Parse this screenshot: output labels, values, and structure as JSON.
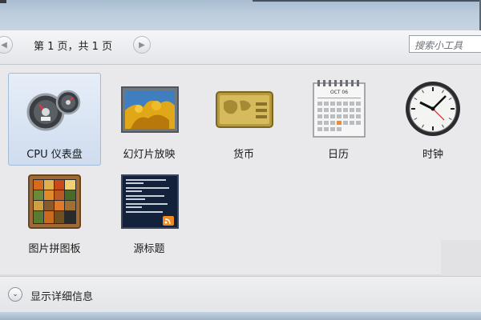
{
  "toolbar": {
    "page_info": "第 1 页，共 1 页",
    "prev_icon": "chevron-left-icon",
    "next_icon": "chevron-right-icon",
    "search_placeholder": "搜索小工具"
  },
  "gadgets": [
    {
      "label": "CPU 仪表盘",
      "icon": "cpu-meter-icon",
      "selected": true
    },
    {
      "label": "幻灯片放映",
      "icon": "slideshow-icon",
      "selected": false
    },
    {
      "label": "货币",
      "icon": "currency-icon",
      "selected": false
    },
    {
      "label": "日历",
      "icon": "calendar-icon",
      "selected": false
    },
    {
      "label": "时钟",
      "icon": "clock-icon",
      "selected": false
    },
    {
      "label": "图片拼图板",
      "icon": "picture-puzzle-icon",
      "selected": false
    },
    {
      "label": "源标题",
      "icon": "feed-headlines-icon",
      "selected": false
    }
  ],
  "calendar_thumb": {
    "month": "OCT 06"
  },
  "footer": {
    "details_label": "显示详细信息",
    "toggle_icon": "chevron-down-circle-icon"
  },
  "colors": {
    "selection": "#cfdcee",
    "selection_border": "#a3bcd9",
    "title_bar": "#bccddd"
  }
}
